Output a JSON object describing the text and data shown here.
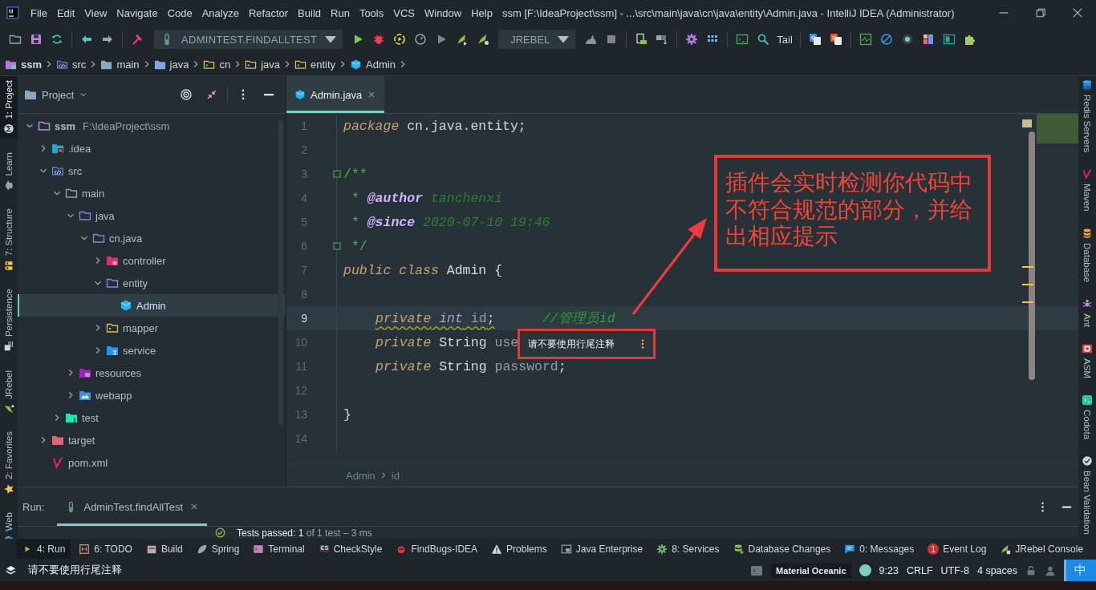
{
  "window": {
    "title": "ssm [F:\\IdeaProject\\ssm] - ...\\src\\main\\java\\cn\\java\\entity\\Admin.java - IntelliJ IDEA (Administrator)"
  },
  "menu": [
    "File",
    "Edit",
    "View",
    "Navigate",
    "Code",
    "Analyze",
    "Refactor",
    "Build",
    "Run",
    "Tools",
    "VCS",
    "Window",
    "Help"
  ],
  "toolbar": {
    "run_config": "ADMINTEST.FINDALLTEST",
    "jrebel": "JREBEL",
    "tail": "Tail"
  },
  "breadcrumb": [
    {
      "label": "ssm",
      "kind": "module"
    },
    {
      "label": "src",
      "kind": "source-root"
    },
    {
      "label": "main",
      "kind": "folder"
    },
    {
      "label": "java",
      "kind": "java-root"
    },
    {
      "label": "cn",
      "kind": "package"
    },
    {
      "label": "java",
      "kind": "package"
    },
    {
      "label": "entity",
      "kind": "package"
    },
    {
      "label": "Admin",
      "kind": "class"
    }
  ],
  "left_strip": [
    {
      "label": "1: Project",
      "kind": "project",
      "selected": true
    },
    {
      "label": "Learn",
      "kind": "learn",
      "selected": false
    },
    {
      "label": "7: Structure",
      "kind": "structure",
      "selected": false
    },
    {
      "label": "Persistence",
      "kind": "persistence",
      "selected": false
    },
    {
      "label": "JRebel",
      "kind": "jrebel",
      "selected": false
    },
    {
      "label": "2: Favorites",
      "kind": "favorites",
      "selected": false
    },
    {
      "label": "Web",
      "kind": "web",
      "selected": false
    }
  ],
  "project": {
    "title": "Project",
    "tree": [
      {
        "label": "ssm",
        "path": "F:\\IdeaProject\\ssm",
        "kind": "module",
        "expanded": true,
        "selected": false,
        "children": [
          {
            "label": ".idea",
            "kind": "idea-folder",
            "expanded": false,
            "selected": false
          },
          {
            "label": "src",
            "kind": "source-root",
            "expanded": true,
            "selected": false,
            "children": [
              {
                "label": "main",
                "kind": "folder",
                "expanded": true,
                "selected": false,
                "children": [
                  {
                    "label": "java",
                    "kind": "java-root",
                    "expanded": true,
                    "selected": false,
                    "children": [
                      {
                        "label": "cn.java",
                        "kind": "package",
                        "expanded": true,
                        "selected": false,
                        "children": [
                          {
                            "label": "controller",
                            "kind": "controller-package",
                            "expanded": false,
                            "selected": false
                          },
                          {
                            "label": "entity",
                            "kind": "package",
                            "expanded": true,
                            "selected": false,
                            "children": [
                              {
                                "label": "Admin",
                                "kind": "class",
                                "selected": true
                              }
                            ]
                          },
                          {
                            "label": "mapper",
                            "kind": "mapper-package",
                            "expanded": false,
                            "selected": false
                          },
                          {
                            "label": "service",
                            "kind": "service-package",
                            "expanded": false,
                            "selected": false
                          }
                        ]
                      }
                    ]
                  },
                  {
                    "label": "resources",
                    "kind": "resources-root",
                    "expanded": false,
                    "selected": false
                  },
                  {
                    "label": "webapp",
                    "kind": "web-folder",
                    "expanded": false,
                    "selected": false
                  }
                ]
              },
              {
                "label": "test",
                "kind": "test-root",
                "expanded": false,
                "selected": false
              }
            ]
          },
          {
            "label": "target",
            "kind": "excluded-folder",
            "expanded": false,
            "selected": false
          },
          {
            "label": "pom.xml",
            "kind": "maven-file",
            "selected": false
          }
        ]
      }
    ]
  },
  "editor": {
    "tabs": [
      {
        "label": "Admin.java",
        "selected": true
      }
    ],
    "lines": [
      {
        "number": "1",
        "current": false,
        "fold": false,
        "indented": false,
        "tokens": [
          {
            "kind": "keyword",
            "text": "package"
          },
          {
            "kind": "plain",
            "text": " cn.java.entity;"
          }
        ]
      },
      {
        "number": "2",
        "current": false,
        "fold": false
      },
      {
        "number": "3",
        "current": false,
        "fold": true,
        "indented": false,
        "tokens": [
          {
            "kind": "comment",
            "text": "/**"
          }
        ]
      },
      {
        "number": "4",
        "current": false,
        "fold": false,
        "indented": false,
        "tokens": [
          {
            "kind": "comment",
            "text": " * "
          },
          {
            "kind": "doctag",
            "text": "@author"
          },
          {
            "kind": "docvalue",
            "text": " tanchenxi"
          }
        ]
      },
      {
        "number": "5",
        "current": false,
        "fold": false,
        "indented": false,
        "tokens": [
          {
            "kind": "comment",
            "text": " * "
          },
          {
            "kind": "doctag",
            "text": "@since"
          },
          {
            "kind": "docvalue",
            "text": " 2020-07-10 19:46"
          }
        ]
      },
      {
        "number": "6",
        "current": false,
        "fold": true,
        "indented": false,
        "tokens": [
          {
            "kind": "comment",
            "text": " */"
          }
        ]
      },
      {
        "number": "7",
        "current": false,
        "fold": false,
        "indented": false,
        "tokens": [
          {
            "kind": "keyword",
            "text": "public class"
          },
          {
            "kind": "plain",
            "text": " Admin {"
          }
        ]
      },
      {
        "number": "8",
        "current": false,
        "fold": false
      },
      {
        "number": "9",
        "current": true,
        "fold": false,
        "indented": true,
        "tokens": [
          {
            "kind": "keyword",
            "text": "private",
            "warning": true
          },
          {
            "kind": "primitive",
            "text": " int",
            "warning": true
          },
          {
            "kind": "field",
            "text": " id",
            "warning": true
          },
          {
            "kind": "plain",
            "text": ";",
            "warning": true
          },
          {
            "kind": "trailing-comment",
            "text": "//管理员id",
            "warning": false
          }
        ]
      },
      {
        "number": "10",
        "current": false,
        "fold": false,
        "indented": true,
        "tokens": [
          {
            "kind": "keyword",
            "text": "private"
          },
          {
            "kind": "plain",
            "text": " String "
          },
          {
            "kind": "field",
            "text": "use"
          }
        ]
      },
      {
        "number": "11",
        "current": false,
        "fold": false,
        "indented": true,
        "tokens": [
          {
            "kind": "keyword",
            "text": "private"
          },
          {
            "kind": "plain",
            "text": " String "
          },
          {
            "kind": "field",
            "text": "password"
          },
          {
            "kind": "plain",
            "text": ";"
          }
        ]
      },
      {
        "number": "12",
        "current": false,
        "fold": false
      },
      {
        "number": "13",
        "current": false,
        "fold": false,
        "indented": false,
        "tokens": [
          {
            "kind": "plain",
            "text": "}"
          }
        ]
      },
      {
        "number": "14",
        "current": false,
        "fold": false
      }
    ],
    "popup": "请不要使用行尾注释",
    "breadcrumb": [
      "Admin",
      "id"
    ]
  },
  "annotation": {
    "text": "插件会实时检测你代码中不符合规范的部分，并给出相应提示"
  },
  "right_strip": [
    {
      "label": "Redis Servers",
      "kind": "redis"
    },
    {
      "label": "Maven",
      "kind": "maven"
    },
    {
      "label": "Database",
      "kind": "database"
    },
    {
      "label": "Ant",
      "kind": "ant"
    },
    {
      "label": "ASM",
      "kind": "asm"
    },
    {
      "label": "Codota",
      "kind": "codota"
    },
    {
      "label": "Bean Validation",
      "kind": "bean"
    }
  ],
  "run": {
    "label": "Run:",
    "tabs": [
      {
        "label": "AdminTest.findAllTest",
        "selected": true
      }
    ],
    "result": "**Tests passed: 1** of 1 test – 3 ms"
  },
  "tool_windows": [
    {
      "label": "4: Run",
      "kind": "run",
      "selected": true
    },
    {
      "label": "6: TODO",
      "kind": "todo",
      "selected": false
    },
    {
      "label": "Build",
      "kind": "build",
      "selected": false
    },
    {
      "label": "Spring",
      "kind": "spring",
      "selected": false
    },
    {
      "label": "Terminal",
      "kind": "terminal",
      "selected": false
    },
    {
      "label": "CheckStyle",
      "kind": "checkstyle",
      "selected": false
    },
    {
      "label": "FindBugs-IDEA",
      "kind": "findbugs",
      "selected": false
    },
    {
      "label": "Problems",
      "kind": "problems",
      "selected": false
    },
    {
      "label": "Java Enterprise",
      "kind": "enterprise",
      "selected": false
    },
    {
      "label": "8: Services",
      "kind": "services",
      "selected": false
    },
    {
      "label": "Database Changes",
      "kind": "dbchanges",
      "selected": false
    },
    {
      "label": "0: Messages",
      "kind": "messages",
      "selected": false
    },
    {
      "label": "Event Log",
      "kind": "eventlog",
      "badge": "1",
      "selected": false
    },
    {
      "label": "JRebel Console",
      "kind": "jrebel",
      "selected": false
    }
  ],
  "status": {
    "message": "请不要使用行尾注释",
    "theme": "Material Oceanic",
    "position": "9:23",
    "line_separator": "CRLF",
    "encoding": "UTF-8",
    "indent": "4 spaces",
    "ime": "中"
  }
}
